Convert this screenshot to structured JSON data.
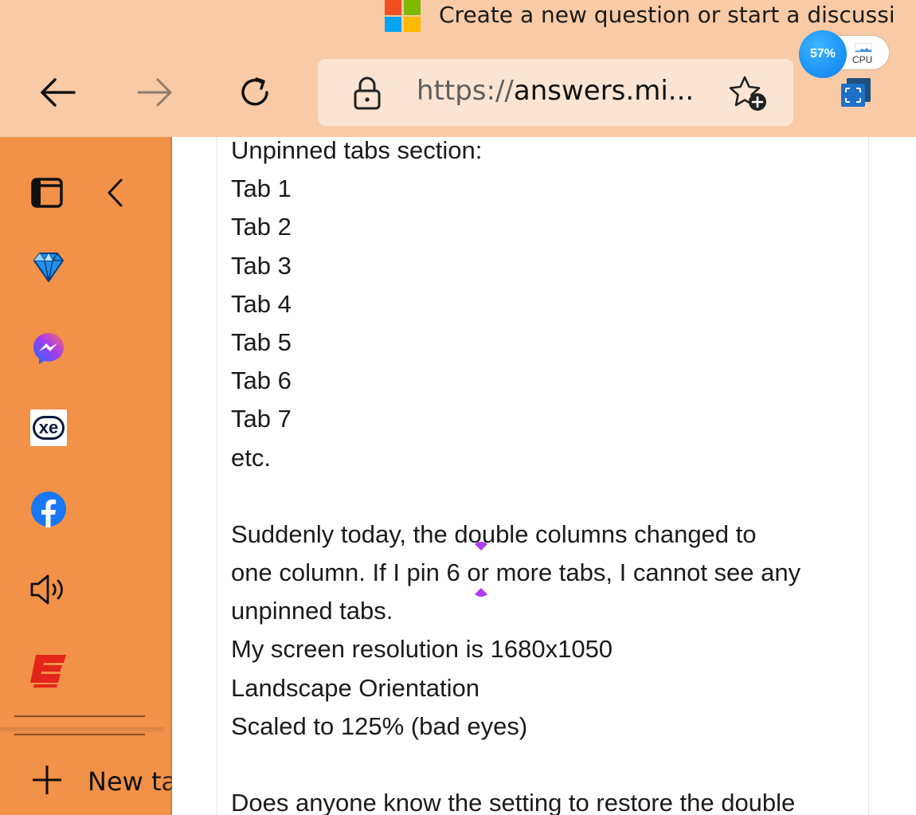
{
  "window": {
    "tab_title": "Create a new question or start a discussi"
  },
  "toolbar": {
    "back": "back-arrow-icon",
    "forward": "forward-arrow-icon",
    "refresh": "refresh-icon",
    "url_scheme": "https://",
    "url_host": "answers.mi...",
    "favorite": "add-favorite-icon",
    "collections": "collections-icon"
  },
  "cpu_widget": {
    "percent": "57%",
    "label": "CPU"
  },
  "sidebar": {
    "items": [
      {
        "name": "vertical-tabs-icon"
      },
      {
        "name": "collapse-chevron-icon"
      },
      {
        "name": "diamond-site-icon"
      },
      {
        "name": "messenger-icon"
      },
      {
        "name": "xe-icon"
      },
      {
        "name": "facebook-icon"
      },
      {
        "name": "speaker-icon"
      },
      {
        "name": "espn-icon"
      }
    ],
    "xe_text": "xe",
    "new_tab_label": "New tab"
  },
  "post": {
    "lines": [
      "Unpinned tabs section:",
      "Tab 1",
      "Tab 2",
      "Tab 3",
      "Tab 4",
      "Tab 5",
      "Tab 6",
      "Tab 7",
      "etc.",
      "",
      "Suddenly today, the double columns changed to",
      "one column. If I pin 6 or more tabs, I cannot see any",
      "unpinned tabs.",
      "My screen resolution is 1680x1050",
      "Landscape Orientation",
      "Scaled to 125% (bad eyes)",
      "",
      "Does anyone know the setting to restore the double"
    ]
  },
  "colors": {
    "toolbar_bg": "#f8cba6",
    "sidebar_bg": "#f29148",
    "address_bg": "#fbe4d2",
    "cpu_blue": "#1a8ef5"
  }
}
